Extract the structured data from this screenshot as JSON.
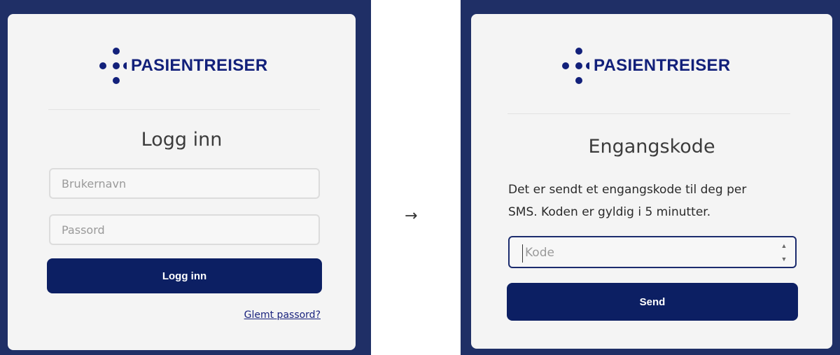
{
  "brand": {
    "name": "PASIENTREISER",
    "color": "#12207a",
    "icon": "pasientreiser-cross-dots-logo"
  },
  "login": {
    "title": "Logg inn",
    "username_placeholder": "Brukernavn",
    "password_placeholder": "Passord",
    "submit_label": "Logg inn",
    "forgot_label": "Glemt passord?"
  },
  "transition": {
    "arrow": "→",
    "icon": "arrow-right-icon"
  },
  "otp": {
    "title": "Engangskode",
    "description_line1": "Det er sendt et engangskode til deg per",
    "description_line2": "SMS. Koden er gyldig i 5 minutter.",
    "code_placeholder": "Kode",
    "submit_label": "Send"
  },
  "colors": {
    "frame": "#1f2f66",
    "card": "#f4f4f4",
    "button": "#0c1f63",
    "link": "#1a237e"
  }
}
